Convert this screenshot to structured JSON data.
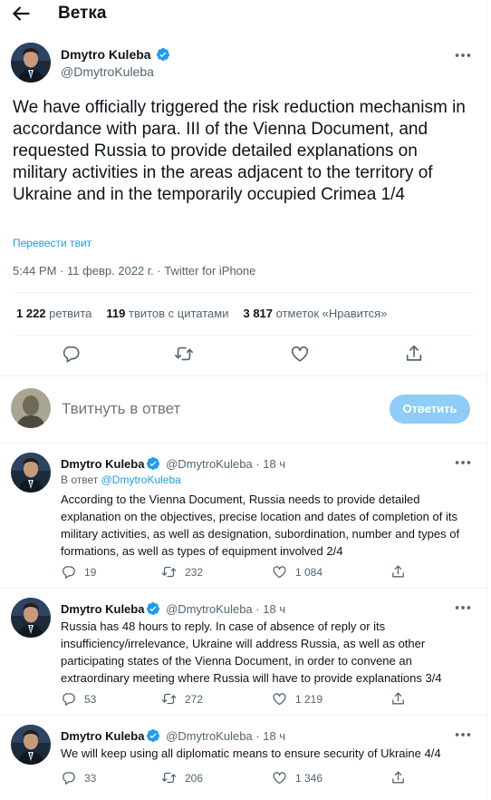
{
  "header": {
    "title": "Ветка"
  },
  "main_tweet": {
    "author_name": "Dmytro Kuleba",
    "handle": "@DmytroKuleba",
    "text": "We have officially triggered the risk reduction mechanism in accordance with para. III of the Vienna Document, and requested Russia to provide detailed explanations on military activities in the areas adjacent to the territory of Ukraine and in the temporarily occupied Crimea 1/4",
    "translate_label": "Перевести твит",
    "meta": "5:44 PM · 11 февр. 2022 г. · Twitter for iPhone",
    "stats": {
      "retweets_count": "1 222",
      "retweets_label": "ретвита",
      "quotes_count": "119",
      "quotes_label": "твитов с цитатами",
      "likes_count": "3 817",
      "likes_label": "отметок «Нравится»"
    }
  },
  "reply_box": {
    "placeholder": "Твитнуть в ответ",
    "button_label": "Ответить"
  },
  "replies": [
    {
      "name": "Dmytro Kuleba",
      "handle": "@DmytroKuleba · 18 ч",
      "reply_prefix": "В ответ",
      "reply_to": "@DmytroKuleba",
      "text": "According to the Vienna Document, Russia needs to provide detailed explanation on the objectives, precise location and dates of completion of its military activities, as well as designation, subordination, number and types of formations, as well as types of equipment involved 2/4",
      "replies": "19",
      "retweets": "232",
      "likes": "1 084"
    },
    {
      "name": "Dmytro Kuleba",
      "handle": "@DmytroKuleba · 18 ч",
      "text": "Russia has 48 hours to reply. In case of absence of reply or its insufficiency/irrelevance, Ukraine will address Russia, as well as other participating states of the Vienna Document, in order to convene an extraordinary meeting where Russia will have to provide explanations 3/4",
      "replies": "53",
      "retweets": "272",
      "likes": "1 219"
    },
    {
      "name": "Dmytro Kuleba",
      "handle": "@DmytroKuleba · 18 ч",
      "text": "We will keep using all diplomatic means to ensure security of Ukraine 4/4",
      "replies": "33",
      "retweets": "206",
      "likes": "1 346"
    }
  ],
  "icons": {
    "back": "arrow-left-icon",
    "verified": "verified-badge-icon",
    "more": "more-dots-icon",
    "reply": "reply-bubble-icon",
    "retweet": "retweet-icon",
    "like": "heart-icon",
    "share": "share-icon"
  },
  "colors": {
    "accent": "#1d9bf0",
    "muted": "#536471",
    "disabled_button": "#8ecdf8"
  }
}
